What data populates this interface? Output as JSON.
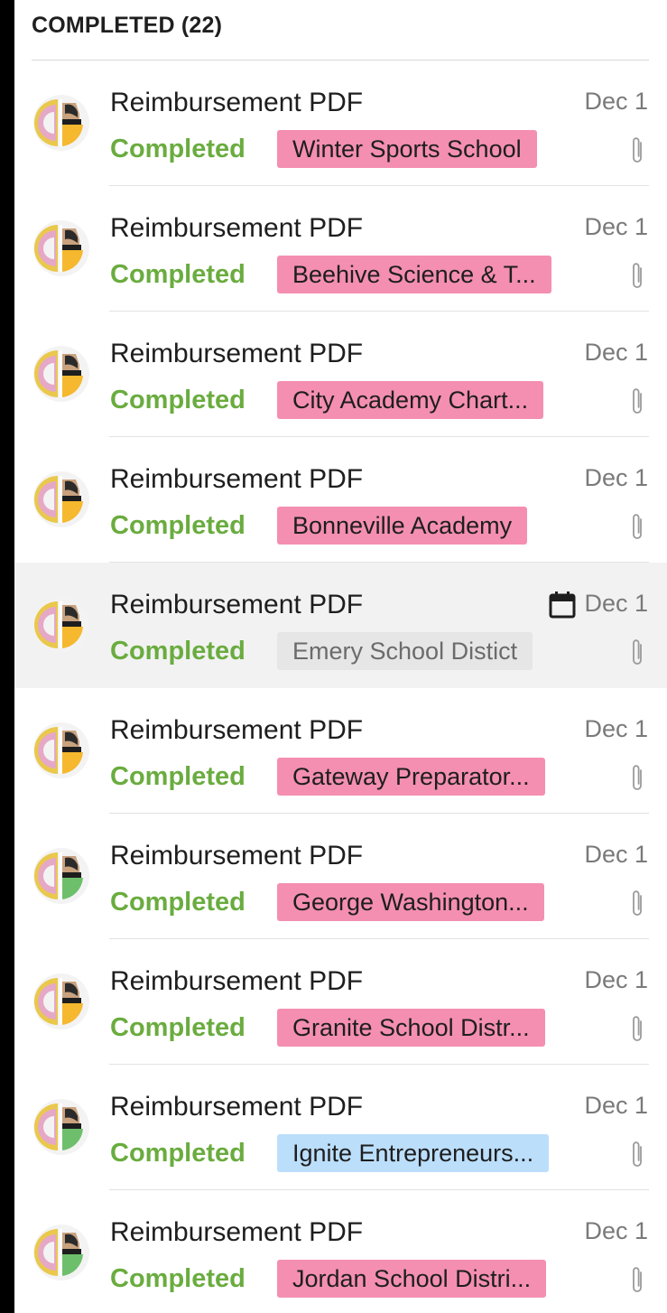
{
  "section": {
    "title": "COMPLETED (22)"
  },
  "colors": {
    "status_green": "#6aac3f",
    "tag_pink": "#f48fb1",
    "tag_blue": "#bbdefb",
    "tag_gray": "#e6e6e6"
  },
  "items": [
    {
      "title": "Reimbursement PDF",
      "date": "Dec 1",
      "status": "Completed",
      "tag": "Winter Sports School",
      "tag_color": "#f48fb1",
      "avatar_badge": "#f5b82e",
      "selected": false,
      "calendar": false
    },
    {
      "title": "Reimbursement PDF",
      "date": "Dec 1",
      "status": "Completed",
      "tag": "Beehive Science & T...",
      "tag_color": "#f48fb1",
      "avatar_badge": "#f5b82e",
      "selected": false,
      "calendar": false
    },
    {
      "title": "Reimbursement PDF",
      "date": "Dec 1",
      "status": "Completed",
      "tag": "City Academy Chart...",
      "tag_color": "#f48fb1",
      "avatar_badge": "#f5b82e",
      "selected": false,
      "calendar": false
    },
    {
      "title": "Reimbursement PDF",
      "date": "Dec 1",
      "status": "Completed",
      "tag": "Bonneville Academy",
      "tag_color": "#f48fb1",
      "avatar_badge": "#f5b82e",
      "selected": false,
      "calendar": false
    },
    {
      "title": "Reimbursement PDF",
      "date": "Dec 1",
      "status": "Completed",
      "tag": "Emery School Distict",
      "tag_color": "#e6e6e6",
      "tag_text_color": "#6b6b6b",
      "avatar_badge": "#f5b82e",
      "selected": true,
      "calendar": true
    },
    {
      "title": "Reimbursement PDF",
      "date": "Dec 1",
      "status": "Completed",
      "tag": "Gateway Preparator...",
      "tag_color": "#f48fb1",
      "avatar_badge": "#f5b82e",
      "selected": false,
      "calendar": false
    },
    {
      "title": "Reimbursement PDF",
      "date": "Dec 1",
      "status": "Completed",
      "tag": "George Washington...",
      "tag_color": "#f48fb1",
      "avatar_badge": "#6dbf6b",
      "selected": false,
      "calendar": false
    },
    {
      "title": "Reimbursement PDF",
      "date": "Dec 1",
      "status": "Completed",
      "tag": "Granite School Distr...",
      "tag_color": "#f48fb1",
      "avatar_badge": "#f5b82e",
      "selected": false,
      "calendar": false
    },
    {
      "title": "Reimbursement PDF",
      "date": "Dec 1",
      "status": "Completed",
      "tag": "Ignite Entrepreneurs...",
      "tag_color": "#bbdefb",
      "avatar_badge": "#6dbf6b",
      "selected": false,
      "calendar": false
    },
    {
      "title": "Reimbursement PDF",
      "date": "Dec 1",
      "status": "Completed",
      "tag": "Jordan School Distri...",
      "tag_color": "#f48fb1",
      "avatar_badge": "#6dbf6b",
      "selected": false,
      "calendar": false
    }
  ]
}
